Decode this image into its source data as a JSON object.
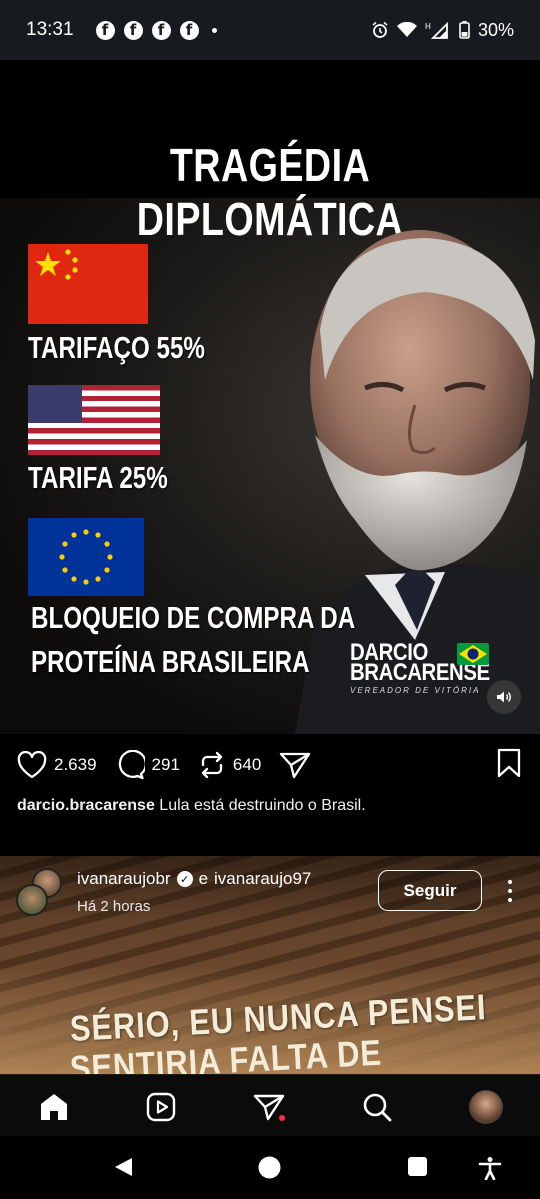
{
  "status_bar": {
    "time": "13:31",
    "battery": "30%",
    "notification_icons": [
      "facebook-icon",
      "facebook-icon",
      "facebook-icon",
      "facebook-icon"
    ],
    "fb_glyph": "f"
  },
  "post": {
    "media": {
      "title": "TRAGÉDIA DIPLOMÁTICA",
      "china_label": "TARIFAÇO 55%",
      "usa_label": "TARIFA 25%",
      "eu_label_line1": "BLOQUEIO DE COMPRA DA",
      "eu_label_line2": "PROTEÍNA BRASILEIRA",
      "brand_line1": "DARCIO",
      "brand_line2": "BRACARENSE",
      "brand_subtitle": "VEREADOR DE VITÓRIA"
    },
    "likes": "2.639",
    "comments": "291",
    "reposts": "640",
    "caption_user": "darcio.bracarense",
    "caption_text": " Lula está destruindo o Brasil."
  },
  "next_post": {
    "username": "ivanaraujobr",
    "verified_glyph": "✓",
    "collab_joiner": "e",
    "collab_user": "ivanaraujo97",
    "time": "Há 2 horas",
    "follow_label": "Seguir",
    "overlay_line1": "SÉRIO, EU NUNCA PENSEI",
    "overlay_line2": "SENTIRIA FALTA DE"
  },
  "colors": {
    "china_red": "#de2910",
    "usa_red": "#b22234",
    "usa_blue": "#3c3b6e",
    "eu_blue": "#003399",
    "notification_red": "#ff3040"
  }
}
